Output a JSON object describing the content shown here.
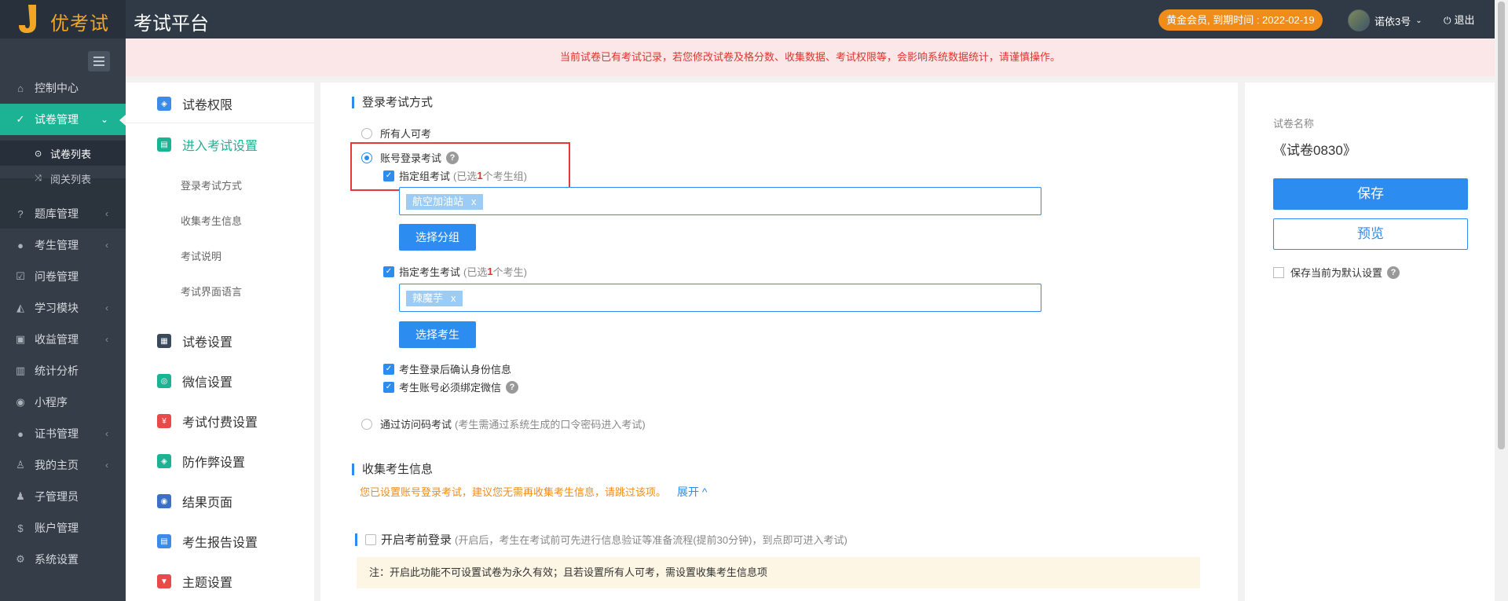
{
  "header": {
    "logo_text": "优考试",
    "platform_title": "考试平台",
    "vip_badge": "黄金会员, 到期时间 : 2022-02-19",
    "user_name": "诺依3号",
    "logout_label": "退出"
  },
  "sidebar": {
    "items": [
      {
        "label": "控制中心",
        "icon": "home-icon"
      },
      {
        "label": "试卷管理",
        "icon": "check-circle-icon"
      },
      {
        "label": "题库管理",
        "icon": "question-circle-icon"
      },
      {
        "label": "考生管理",
        "icon": "user-icon"
      },
      {
        "label": "问卷管理",
        "icon": "checkbox-icon"
      },
      {
        "label": "学习模块",
        "icon": "graduation-cap-icon"
      },
      {
        "label": "收益管理",
        "icon": "money-icon"
      },
      {
        "label": "统计分析",
        "icon": "bar-chart-icon"
      },
      {
        "label": "小程序",
        "icon": "wechat-icon"
      },
      {
        "label": "证书管理",
        "icon": "certificate-icon"
      },
      {
        "label": "我的主页",
        "icon": "person-icon"
      },
      {
        "label": "子管理员",
        "icon": "admin-icon"
      },
      {
        "label": "账户管理",
        "icon": "dollar-icon"
      },
      {
        "label": "系统设置",
        "icon": "gear-icon"
      }
    ],
    "sub_items": [
      {
        "label": "试卷列表",
        "icon": "check-circle-icon"
      },
      {
        "label": "阅关列表",
        "icon": "shuffle-icon"
      }
    ]
  },
  "warning_bar": "当前试卷已有考试记录，若您修改试卷及格分数、收集数据、考试权限等，会影响系统数据统计，请谨慎操作。",
  "left_menu": {
    "items": [
      {
        "label": "试卷权限",
        "color": "#3b8ce8"
      },
      {
        "label": "进入考试设置",
        "color": "#1bb394"
      },
      {
        "label": "试卷设置",
        "color": "#3a4a5c"
      },
      {
        "label": "微信设置",
        "color": "#1bb394"
      },
      {
        "label": "考试付费设置",
        "color": "#e84a4a"
      },
      {
        "label": "防作弊设置",
        "color": "#1bb394"
      },
      {
        "label": "结果页面",
        "color": "#3b6fc8"
      },
      {
        "label": "考生报告设置",
        "color": "#3b8ce8"
      },
      {
        "label": "主题设置",
        "color": "#e84a4a"
      }
    ],
    "sub_items": [
      "登录考试方式",
      "收集考生信息",
      "考试说明",
      "考试界面语言"
    ]
  },
  "login_section": {
    "title": "登录考试方式",
    "opt_all": "所有人可考",
    "opt_account": "账号登录考试",
    "group_exam_label": "指定组考试",
    "group_exam_note_pre": "(已选",
    "group_exam_count": "1",
    "group_exam_note_post": "个考生组)",
    "group_tag": "航空加油站",
    "choose_group_btn": "选择分组",
    "student_exam_label": "指定考生考试",
    "student_exam_note_pre": "(已选",
    "student_exam_count": "1",
    "student_exam_note_post": "个考生)",
    "student_tag": "辣魔芋",
    "choose_student_btn": "选择考生",
    "confirm_identity": "考生登录后确认身份信息",
    "bind_wechat": "考生账号必须绑定微信",
    "opt_access_code": "通过访问码考试",
    "access_code_note": "(考生需通过系统生成的口令密码进入考试)"
  },
  "collect_section": {
    "title": "收集考生信息",
    "hint": "您已设置账号登录考试，建议您无需再收集考生信息，请跳过该项。",
    "expand": "展开 ^",
    "pre_login_label": "开启考前登录",
    "pre_login_note": "(开启后，考生在考试前可先进行信息验证等准备流程(提前30分钟)，到点即可进入考试)",
    "note": "注：开启此功能不可设置试卷为永久有效；且若设置所有人可考，需设置收集考生信息项"
  },
  "right_panel": {
    "name_label": "试卷名称",
    "name_value": "《试卷0830》",
    "save_btn": "保存",
    "preview_btn": "预览",
    "default_label": "保存当前为默认设置"
  }
}
